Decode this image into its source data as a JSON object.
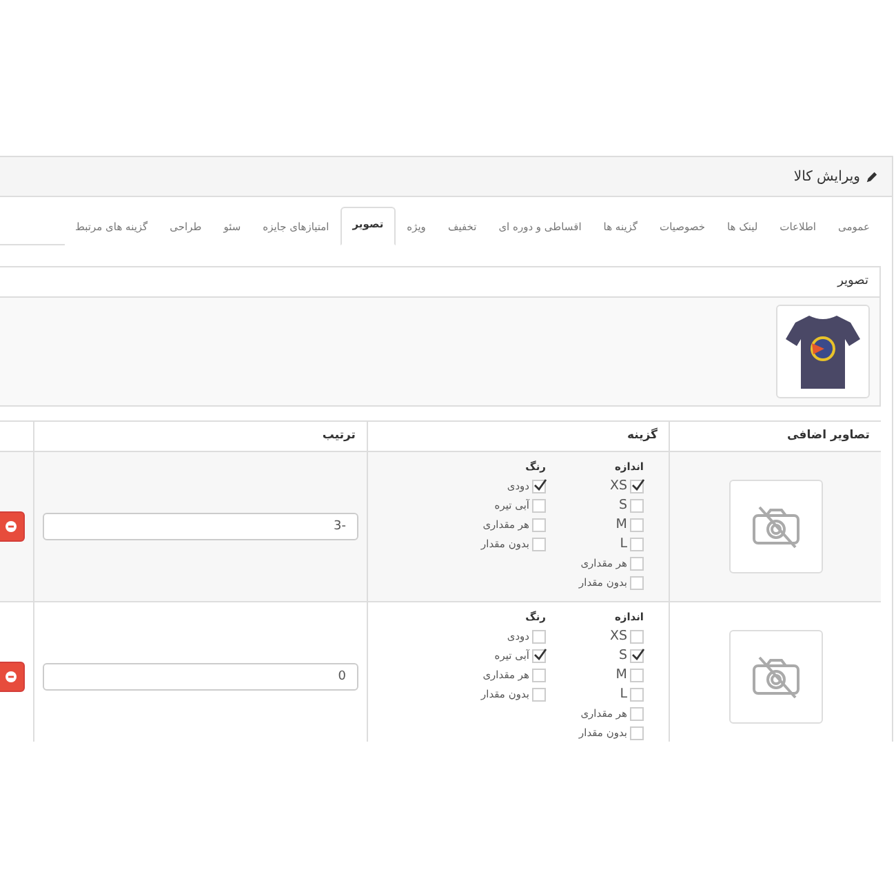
{
  "panel": {
    "title": "ویرایش کالا"
  },
  "tabs": [
    {
      "label": "عمومی",
      "selected": false
    },
    {
      "label": "اطلاعات",
      "selected": false
    },
    {
      "label": "لینک ها",
      "selected": false
    },
    {
      "label": "خصوصیات",
      "selected": false
    },
    {
      "label": "گزینه ها",
      "selected": false
    },
    {
      "label": "اقساطی و دوره ای",
      "selected": false
    },
    {
      "label": "تخفیف",
      "selected": false
    },
    {
      "label": "ویژه",
      "selected": false
    },
    {
      "label": "تصویر",
      "selected": true
    },
    {
      "label": "امتیازهای جایزه",
      "selected": false
    },
    {
      "label": "سئو",
      "selected": false
    },
    {
      "label": "طراحی",
      "selected": false
    },
    {
      "label": "گزینه های مرتبط",
      "selected": false
    }
  ],
  "image_section": {
    "title": "تصویر"
  },
  "table": {
    "columns": [
      "تصاویر اضافی",
      "گزینه",
      "ترتیب"
    ],
    "rows": [
      {
        "groups": [
          {
            "title": "اندازه",
            "options": [
              {
                "label": "XS",
                "checked": true
              },
              {
                "label": "S",
                "checked": false
              },
              {
                "label": "M",
                "checked": false
              },
              {
                "label": "L",
                "checked": false
              },
              {
                "label": "هر مقداری",
                "checked": false
              },
              {
                "label": "بدون مقدار",
                "checked": false
              }
            ]
          },
          {
            "title": "رنگ",
            "options": [
              {
                "label": "دودی",
                "checked": true
              },
              {
                "label": "آبی تیره",
                "checked": false
              },
              {
                "label": "هر مقداری",
                "checked": false
              },
              {
                "label": "بدون مقدار",
                "checked": false
              }
            ]
          }
        ],
        "order": "-3"
      },
      {
        "groups": [
          {
            "title": "اندازه",
            "options": [
              {
                "label": "XS",
                "checked": false
              },
              {
                "label": "S",
                "checked": true
              },
              {
                "label": "M",
                "checked": false
              },
              {
                "label": "L",
                "checked": false
              },
              {
                "label": "هر مقداری",
                "checked": false
              },
              {
                "label": "بدون مقدار",
                "checked": false
              }
            ]
          },
          {
            "title": "رنگ",
            "options": [
              {
                "label": "دودی",
                "checked": false
              },
              {
                "label": "آبی تیره",
                "checked": true
              },
              {
                "label": "هر مقداری",
                "checked": false
              },
              {
                "label": "بدون مقدار",
                "checked": false
              }
            ]
          }
        ],
        "order": "0"
      }
    ]
  }
}
